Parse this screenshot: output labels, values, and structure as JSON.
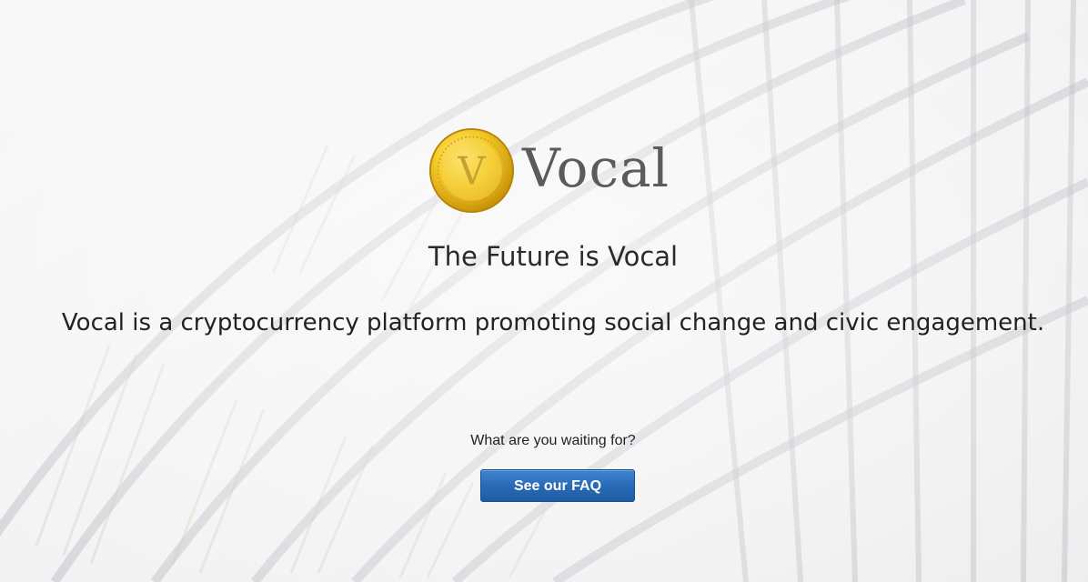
{
  "brand": {
    "coin_letter": "V",
    "name": "Vocal"
  },
  "hero": {
    "tagline": "The Future is Vocal",
    "description": "Vocal is a cryptocurrency platform promoting social change and civic engagement."
  },
  "cta": {
    "prompt": "What are you waiting for?",
    "button_label": "See our FAQ"
  },
  "colors": {
    "button": "#2a6ab6",
    "brand_text": "#5b5b5b",
    "coin_gold": "#f2c321"
  },
  "background": {
    "icon": "library-shelves-image"
  }
}
